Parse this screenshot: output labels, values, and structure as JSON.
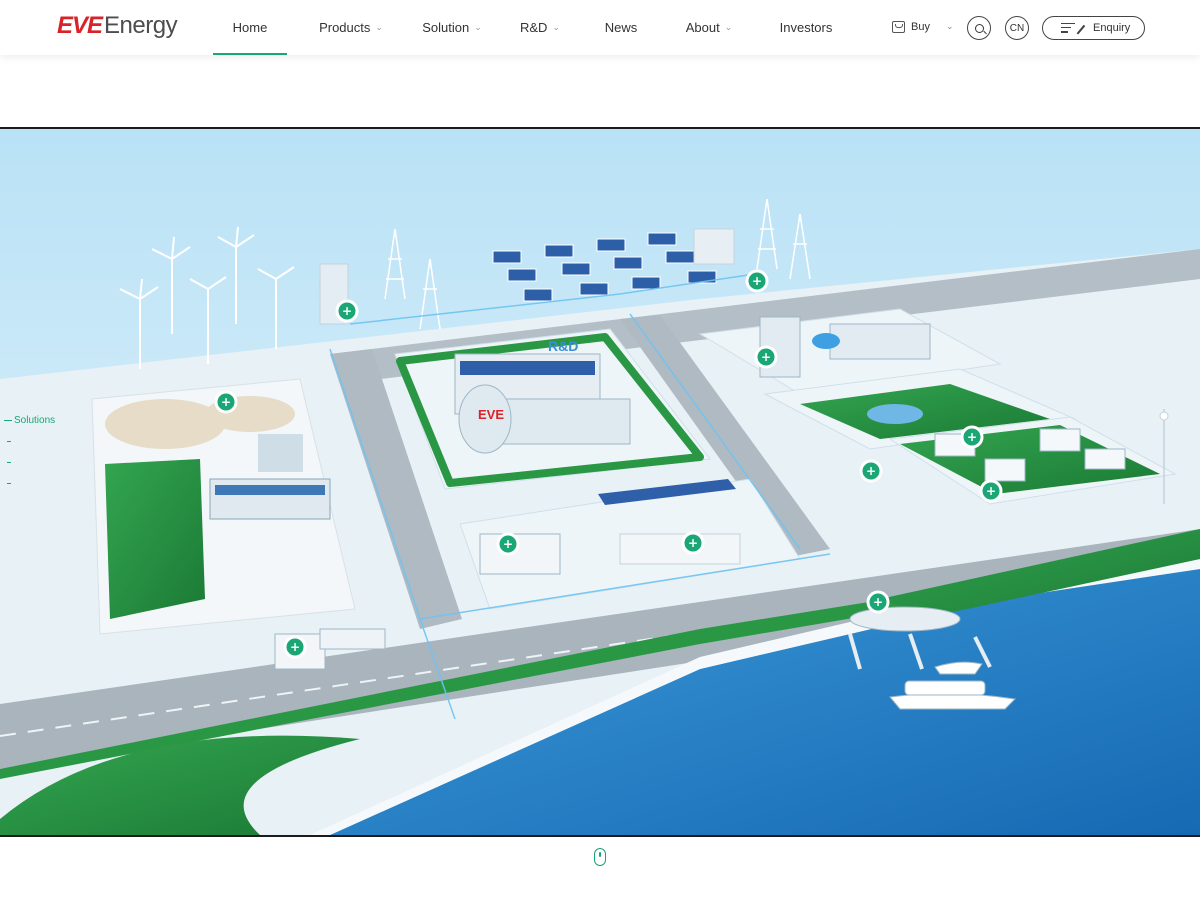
{
  "brand": {
    "logo_main": "EVE",
    "logo_sub": "Energy"
  },
  "nav": {
    "items": [
      {
        "label": "Home",
        "active": true,
        "dropdown": false
      },
      {
        "label": "Products",
        "active": false,
        "dropdown": true
      },
      {
        "label": "Solution",
        "active": false,
        "dropdown": true
      },
      {
        "label": "R&D",
        "active": false,
        "dropdown": true
      },
      {
        "label": "News",
        "active": false,
        "dropdown": false
      },
      {
        "label": "About",
        "active": false,
        "dropdown": true
      },
      {
        "label": "Investors",
        "active": false,
        "dropdown": false
      }
    ],
    "chevron": "⌄"
  },
  "actions": {
    "buy_label": "Buy",
    "language_label": "CN",
    "enquiry_label": "Enquiry"
  },
  "side_nav": {
    "items": [
      "Solutions",
      "",
      "",
      ""
    ]
  },
  "scene": {
    "hotspot_symbol": "+",
    "building_sign": "EVE",
    "rnd_sign": "R&D"
  },
  "colors": {
    "accent": "#1aa675",
    "brand_red": "#d9232a",
    "sea": "#1e7fc4",
    "grass": "#1f8a3c",
    "road": "#a9b4bd"
  }
}
